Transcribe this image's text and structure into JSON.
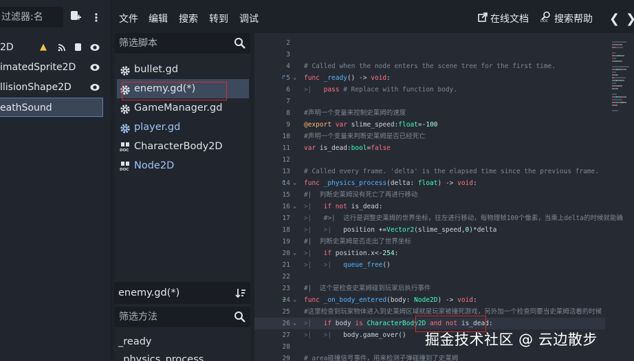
{
  "scene": {
    "filter_placeholder": "过滤器:名",
    "nodes": [
      {
        "label": "2D"
      },
      {
        "label": "imatedSprite2D"
      },
      {
        "label": "llisionShape2D"
      },
      {
        "label": "eathSound"
      }
    ]
  },
  "menubar": {
    "items": [
      "文件",
      "编辑",
      "搜索",
      "转到",
      "调试"
    ],
    "online_docs": "在线文档",
    "search_help": "搜索帮助"
  },
  "scripts": {
    "filter_placeholder": "筛选脚本",
    "items": [
      {
        "label": "bullet.gd",
        "icon": "gear-icon"
      },
      {
        "label": "enemy.gd(*)",
        "icon": "gear-icon"
      },
      {
        "label": "GameManager.gd",
        "icon": "gear-icon"
      },
      {
        "label": "player.gd",
        "icon": "gear-icon"
      },
      {
        "label": "CharacterBody2D",
        "icon": "doc-icon"
      },
      {
        "label": "Node2D",
        "icon": "doc-icon"
      }
    ],
    "current_file": "enemy.gd(*)",
    "methods_filter_placeholder": "筛选方法",
    "methods": [
      "_ready",
      "_physics_process"
    ]
  },
  "code": {
    "lines": [
      {
        "n": "2",
        "segments": []
      },
      {
        "n": "3",
        "segments": []
      },
      {
        "n": "4",
        "segments": [
          [
            "c-cmt",
            "# Called when the node enters the scene tree for the first time."
          ]
        ]
      },
      {
        "n": "5",
        "mark": "override",
        "fold": "⌄",
        "segments": [
          [
            "c-kw",
            "func "
          ],
          [
            "c-fn",
            "_ready"
          ],
          [
            "c-tx",
            "() -> "
          ],
          [
            "c-kw",
            "void"
          ],
          [
            "c-tx",
            ":"
          ]
        ]
      },
      {
        "n": "6",
        "segments": [
          [
            "c-tab",
            ">|   "
          ],
          [
            "c-kw",
            "pass "
          ],
          [
            "c-cmt",
            "# Replace with function body."
          ]
        ]
      },
      {
        "n": "7",
        "segments": []
      },
      {
        "n": "8",
        "segments": [
          [
            "c-cmt",
            "#声明一个变量来控制史莱姆的速度"
          ]
        ]
      },
      {
        "n": "9",
        "segments": [
          [
            "c-ann",
            "@export "
          ],
          [
            "c-kw",
            "var "
          ],
          [
            "c-tx",
            "slime_speed:"
          ],
          [
            "c-ty",
            "float"
          ],
          [
            "c-tx",
            "=-"
          ],
          [
            "c-num",
            "100"
          ]
        ]
      },
      {
        "n": "10",
        "segments": [
          [
            "c-cmt",
            "#声明一个变量来判断史莱姆是否已经死亡"
          ]
        ]
      },
      {
        "n": "11",
        "segments": [
          [
            "c-kw",
            "var "
          ],
          [
            "c-tx",
            "is_dead:"
          ],
          [
            "c-ty",
            "bool"
          ],
          [
            "c-tx",
            "="
          ],
          [
            "c-kw",
            "false"
          ]
        ]
      },
      {
        "n": "12",
        "segments": []
      },
      {
        "n": "13",
        "segments": [
          [
            "c-cmt",
            "# Called every frame. 'delta' is the elapsed time since the previous frame."
          ]
        ]
      },
      {
        "n": "14",
        "mark": "override",
        "fold": "⌄",
        "segments": [
          [
            "c-kw",
            "func "
          ],
          [
            "c-fn",
            "_physics_process"
          ],
          [
            "c-tx",
            "(delta: "
          ],
          [
            "c-ty",
            "float"
          ],
          [
            "c-tx",
            ") -> "
          ],
          [
            "c-kw",
            "void"
          ],
          [
            "c-tx",
            ":"
          ]
        ]
      },
      {
        "n": "15",
        "segments": [
          [
            "c-cmt",
            "#|  判断史莱姆没有死亡了再进行移动"
          ]
        ]
      },
      {
        "n": "16",
        "fold": "⌄",
        "segments": [
          [
            "c-tab",
            ">|   "
          ],
          [
            "c-kw",
            "if not "
          ],
          [
            "c-tx",
            "is_dead:"
          ]
        ]
      },
      {
        "n": "17",
        "segments": [
          [
            "c-tab",
            ">|   "
          ],
          [
            "c-cmt",
            "#>|  这行是调整史莱姆的世界坐标，往左进行移动，每物理帧100个像素，当乘上delta的时候就能确"
          ]
        ]
      },
      {
        "n": "18",
        "segments": [
          [
            "c-tab",
            ">|   >|   "
          ],
          [
            "c-tx",
            "position +="
          ],
          [
            "c-ty",
            "Vector2"
          ],
          [
            "c-tx",
            "(slime_speed,"
          ],
          [
            "c-num",
            "0"
          ],
          [
            "c-tx",
            ")*delta"
          ]
        ]
      },
      {
        "n": "19",
        "segments": [
          [
            "c-cmt",
            "#|  判断史莱姆是否走出了世界坐标"
          ]
        ]
      },
      {
        "n": "20",
        "fold": "⌄",
        "segments": [
          [
            "c-tab",
            ">|   "
          ],
          [
            "c-kw",
            "if "
          ],
          [
            "c-tx",
            "position.x<-"
          ],
          [
            "c-num",
            "254"
          ],
          [
            "c-tx",
            ":"
          ]
        ]
      },
      {
        "n": "21",
        "segments": [
          [
            "c-tab",
            ">|   >|   "
          ],
          [
            "c-fn",
            "queue_free"
          ],
          [
            "c-tx",
            "()"
          ]
        ]
      },
      {
        "n": "22",
        "segments": []
      },
      {
        "n": "23",
        "segments": [
          [
            "c-cmt",
            "#|  这个是检查史莱姆碰到玩家后执行事件"
          ]
        ]
      },
      {
        "n": "24",
        "mark": "connect",
        "fold": "⌄",
        "segments": [
          [
            "c-kw",
            "func "
          ],
          [
            "c-fn",
            "_on_body_entered"
          ],
          [
            "c-tx",
            "(body: "
          ],
          [
            "c-ty",
            "Node2D"
          ],
          [
            "c-tx",
            ") -> "
          ],
          [
            "c-kw",
            "void"
          ],
          [
            "c-tx",
            ":"
          ]
        ]
      },
      {
        "n": "25",
        "segments": [
          [
            "c-cmt",
            "#这里检查到玩家物体进入到史莱姆区域就是玩家被撞死游戏，另外加一个检查同要当史莱姆活着的时候"
          ]
        ]
      },
      {
        "n": "26",
        "current": true,
        "fold": "⌄",
        "segments": [
          [
            "c-tab",
            ">|   "
          ],
          [
            "c-kw",
            "if "
          ],
          [
            "c-tx",
            "body "
          ],
          [
            "c-kw",
            "is "
          ],
          [
            "c-ty",
            "CharacterBody2D "
          ],
          [
            "c-kw",
            "and not "
          ],
          [
            "c-tx",
            "is_dead:"
          ]
        ]
      },
      {
        "n": "27",
        "segments": [
          [
            "c-tab",
            ">|   >|   "
          ],
          [
            "c-tx",
            "body.game_over()"
          ]
        ]
      },
      {
        "n": "28",
        "segments": []
      },
      {
        "n": "29",
        "segments": [
          [
            "c-cmt",
            "# area碰撞信号事件，用来检测子弹碰撞到了史莱姆"
          ]
        ]
      }
    ]
  },
  "watermark": "掘金技术社区 @ 云边散步",
  "colors": {
    "annotation_red": "#e0262b",
    "keyword": "#ff7085",
    "function": "#57b3ff",
    "type": "#42ffc2",
    "comment": "#7d8794"
  }
}
